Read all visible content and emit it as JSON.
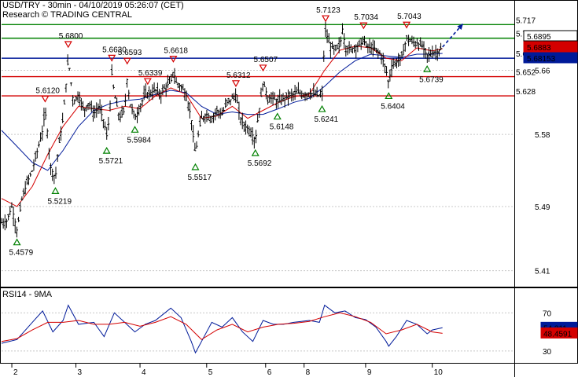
{
  "header": {
    "title": "USD/TRY - 30min - 04/10/2019 05:26:07 (CET)",
    "source": "Research © TRADING CENTRAL"
  },
  "colors": {
    "resistance": "#d40000",
    "support_green": "#008000",
    "pivot": "#001a99",
    "price_tag": "#001a99",
    "ma_fast": "#d40000",
    "ma_slow": "#001a99",
    "rsi_line": "#001a99",
    "rsi_ma": "#d40000",
    "candle": "#000000"
  },
  "chart_data": [
    {
      "type": "line",
      "title": "USD/TRY - 30min - 04/10/2019 05:26:07 (CET)",
      "x_ticks": [
        {
          "label": "2",
          "pos": 0.02
        },
        {
          "label": "3",
          "pos": 0.145
        },
        {
          "label": "4",
          "pos": 0.27
        },
        {
          "label": "5",
          "pos": 0.4
        },
        {
          "label": "6",
          "pos": 0.515
        },
        {
          "label": "8",
          "pos": 0.59
        },
        {
          "label": "9",
          "pos": 0.71
        },
        {
          "label": "10",
          "pos": 0.84
        }
      ],
      "y_ticks": [
        {
          "label": "5.66",
          "value": 5.66
        },
        {
          "label": "5.58",
          "value": 5.58
        },
        {
          "label": "5.49",
          "value": 5.49
        },
        {
          "label": "5.41",
          "value": 5.41
        }
      ],
      "ylim": [
        5.39,
        5.73
      ],
      "horizontal_levels": [
        {
          "value": 5.717,
          "label": "5.717",
          "kind": "support_green"
        },
        {
          "value": 5.7,
          "label": "5.7",
          "kind": "support_green"
        },
        {
          "value": 5.675,
          "label": "5.675",
          "kind": "pivot"
        },
        {
          "value": 5.652,
          "label": "5.652",
          "kind": "resistance"
        },
        {
          "value": 5.628,
          "label": "5.628",
          "kind": "resistance"
        }
      ],
      "price_tags": [
        {
          "label": "5.6895",
          "value": 5.6895,
          "kind": "box_white"
        },
        {
          "label": "5.6883",
          "value": 5.6883,
          "kind": "box_red"
        },
        {
          "label": "5.68153",
          "value": 5.68153,
          "kind": "box_blue"
        }
      ],
      "swing_annotations": [
        {
          "label": "5.4579",
          "t": 0.03,
          "value": 5.4579,
          "type": "low"
        },
        {
          "label": "5.6120",
          "t": 0.085,
          "value": 5.612,
          "type": "high"
        },
        {
          "label": "5.5219",
          "t": 0.105,
          "value": 5.5219,
          "type": "low"
        },
        {
          "label": "5.6800",
          "t": 0.13,
          "value": 5.68,
          "type": "high"
        },
        {
          "label": "5.6630",
          "t": 0.215,
          "value": 5.663,
          "type": "high"
        },
        {
          "label": "5.5721",
          "t": 0.205,
          "value": 5.5721,
          "type": "low"
        },
        {
          "label": "5.6593",
          "t": 0.245,
          "value": 5.6593,
          "type": "high"
        },
        {
          "label": "5.5984",
          "t": 0.26,
          "value": 5.5984,
          "type": "low"
        },
        {
          "label": "5.6339",
          "t": 0.285,
          "value": 5.6339,
          "type": "high"
        },
        {
          "label": "5.6618",
          "t": 0.335,
          "value": 5.6618,
          "type": "high"
        },
        {
          "label": "5.5517",
          "t": 0.378,
          "value": 5.5517,
          "type": "low"
        },
        {
          "label": "5.6312",
          "t": 0.457,
          "value": 5.6312,
          "type": "high"
        },
        {
          "label": "5.5692",
          "t": 0.495,
          "value": 5.5692,
          "type": "low"
        },
        {
          "label": "5.6507",
          "t": 0.51,
          "value": 5.6507,
          "type": "high"
        },
        {
          "label": "5.6148",
          "t": 0.538,
          "value": 5.6148,
          "type": "low"
        },
        {
          "label": "5.6241",
          "t": 0.625,
          "value": 5.6241,
          "type": "low"
        },
        {
          "label": "5.7123",
          "t": 0.632,
          "value": 5.7123,
          "type": "high"
        },
        {
          "label": "5.7034",
          "t": 0.706,
          "value": 5.7034,
          "type": "high"
        },
        {
          "label": "5.6404",
          "t": 0.755,
          "value": 5.6404,
          "type": "low"
        },
        {
          "label": "5.7043",
          "t": 0.79,
          "value": 5.7043,
          "type": "high"
        },
        {
          "label": "5.6739",
          "t": 0.83,
          "value": 5.6739,
          "type": "low"
        }
      ],
      "price_path": [
        [
          0.0,
          5.47
        ],
        [
          0.01,
          5.472
        ],
        [
          0.02,
          5.49
        ],
        [
          0.03,
          5.46
        ],
        [
          0.04,
          5.5
        ],
        [
          0.05,
          5.52
        ],
        [
          0.06,
          5.535
        ],
        [
          0.07,
          5.56
        ],
        [
          0.08,
          5.585
        ],
        [
          0.085,
          5.61
        ],
        [
          0.09,
          5.58
        ],
        [
          0.095,
          5.54
        ],
        [
          0.105,
          5.525
        ],
        [
          0.11,
          5.56
        ],
        [
          0.12,
          5.6
        ],
        [
          0.13,
          5.675
        ],
        [
          0.14,
          5.62
        ],
        [
          0.15,
          5.63
        ],
        [
          0.16,
          5.61
        ],
        [
          0.17,
          5.62
        ],
        [
          0.18,
          5.605
        ],
        [
          0.19,
          5.615
        ],
        [
          0.2,
          5.595
        ],
        [
          0.205,
          5.578
        ],
        [
          0.21,
          5.6
        ],
        [
          0.215,
          5.655
        ],
        [
          0.22,
          5.63
        ],
        [
          0.23,
          5.6
        ],
        [
          0.24,
          5.61
        ],
        [
          0.245,
          5.65
        ],
        [
          0.25,
          5.62
        ],
        [
          0.26,
          5.6
        ],
        [
          0.27,
          5.615
        ],
        [
          0.28,
          5.63
        ],
        [
          0.29,
          5.632
        ],
        [
          0.3,
          5.635
        ],
        [
          0.31,
          5.63
        ],
        [
          0.32,
          5.64
        ],
        [
          0.33,
          5.645
        ],
        [
          0.335,
          5.66
        ],
        [
          0.34,
          5.645
        ],
        [
          0.35,
          5.64
        ],
        [
          0.36,
          5.63
        ],
        [
          0.37,
          5.6
        ],
        [
          0.375,
          5.57
        ],
        [
          0.378,
          5.555
        ],
        [
          0.385,
          5.585
        ],
        [
          0.39,
          5.6
        ],
        [
          0.4,
          5.605
        ],
        [
          0.41,
          5.6
        ],
        [
          0.42,
          5.61
        ],
        [
          0.43,
          5.605
        ],
        [
          0.44,
          5.62
        ],
        [
          0.45,
          5.625
        ],
        [
          0.457,
          5.63
        ],
        [
          0.465,
          5.6
        ],
        [
          0.475,
          5.59
        ],
        [
          0.485,
          5.585
        ],
        [
          0.495,
          5.572
        ],
        [
          0.5,
          5.6
        ],
        [
          0.51,
          5.645
        ],
        [
          0.52,
          5.625
        ],
        [
          0.53,
          5.625
        ],
        [
          0.538,
          5.62
        ],
        [
          0.55,
          5.625
        ],
        [
          0.56,
          5.628
        ],
        [
          0.57,
          5.63
        ],
        [
          0.58,
          5.632
        ],
        [
          0.59,
          5.63
        ],
        [
          0.6,
          5.632
        ],
        [
          0.61,
          5.63
        ],
        [
          0.62,
          5.628
        ],
        [
          0.625,
          5.628
        ],
        [
          0.63,
          5.7
        ],
        [
          0.632,
          5.71
        ],
        [
          0.64,
          5.69
        ],
        [
          0.65,
          5.685
        ],
        [
          0.66,
          5.69
        ],
        [
          0.665,
          5.712
        ],
        [
          0.67,
          5.69
        ],
        [
          0.68,
          5.685
        ],
        [
          0.69,
          5.69
        ],
        [
          0.7,
          5.692
        ],
        [
          0.706,
          5.7
        ],
        [
          0.71,
          5.69
        ],
        [
          0.72,
          5.688
        ],
        [
          0.73,
          5.685
        ],
        [
          0.74,
          5.68
        ],
        [
          0.75,
          5.66
        ],
        [
          0.755,
          5.643
        ],
        [
          0.76,
          5.665
        ],
        [
          0.77,
          5.67
        ],
        [
          0.78,
          5.675
        ],
        [
          0.79,
          5.7
        ],
        [
          0.8,
          5.695
        ],
        [
          0.81,
          5.694
        ],
        [
          0.82,
          5.69
        ],
        [
          0.83,
          5.678
        ],
        [
          0.84,
          5.682
        ],
        [
          0.85,
          5.683
        ],
        [
          0.86,
          5.689
        ]
      ],
      "ma_fast_path": [
        [
          0.0,
          5.5
        ],
        [
          0.03,
          5.49
        ],
        [
          0.06,
          5.515
        ],
        [
          0.09,
          5.555
        ],
        [
          0.12,
          5.59
        ],
        [
          0.15,
          5.615
        ],
        [
          0.18,
          5.612
        ],
        [
          0.21,
          5.61
        ],
        [
          0.24,
          5.615
        ],
        [
          0.27,
          5.612
        ],
        [
          0.3,
          5.628
        ],
        [
          0.33,
          5.638
        ],
        [
          0.36,
          5.63
        ],
        [
          0.39,
          5.6
        ],
        [
          0.42,
          5.603
        ],
        [
          0.45,
          5.615
        ],
        [
          0.48,
          5.6
        ],
        [
          0.51,
          5.61
        ],
        [
          0.54,
          5.62
        ],
        [
          0.57,
          5.627
        ],
        [
          0.6,
          5.63
        ],
        [
          0.63,
          5.66
        ],
        [
          0.66,
          5.685
        ],
        [
          0.69,
          5.69
        ],
        [
          0.72,
          5.688
        ],
        [
          0.75,
          5.675
        ],
        [
          0.78,
          5.672
        ],
        [
          0.81,
          5.688
        ],
        [
          0.84,
          5.684
        ],
        [
          0.86,
          5.687
        ]
      ],
      "ma_slow_path": [
        [
          0.0,
          5.585
        ],
        [
          0.03,
          5.565
        ],
        [
          0.06,
          5.545
        ],
        [
          0.09,
          5.535
        ],
        [
          0.12,
          5.56
        ],
        [
          0.15,
          5.59
        ],
        [
          0.18,
          5.61
        ],
        [
          0.21,
          5.618
        ],
        [
          0.24,
          5.622
        ],
        [
          0.27,
          5.624
        ],
        [
          0.3,
          5.63
        ],
        [
          0.33,
          5.635
        ],
        [
          0.36,
          5.632
        ],
        [
          0.39,
          5.615
        ],
        [
          0.42,
          5.605
        ],
        [
          0.45,
          5.608
        ],
        [
          0.48,
          5.605
        ],
        [
          0.51,
          5.605
        ],
        [
          0.54,
          5.612
        ],
        [
          0.57,
          5.62
        ],
        [
          0.6,
          5.625
        ],
        [
          0.63,
          5.64
        ],
        [
          0.66,
          5.658
        ],
        [
          0.69,
          5.672
        ],
        [
          0.72,
          5.68
        ],
        [
          0.75,
          5.678
        ],
        [
          0.78,
          5.676
        ],
        [
          0.81,
          5.68
        ],
        [
          0.84,
          5.68
        ],
        [
          0.86,
          5.681
        ]
      ],
      "projection": {
        "from": [
          0.86,
          5.689
        ],
        "to": [
          0.9,
          5.718
        ]
      }
    },
    {
      "type": "line",
      "title": "RSI14 - 9MA",
      "y_ticks": [
        {
          "label": "70",
          "value": 70
        },
        {
          "label": "30",
          "value": 30
        }
      ],
      "ylim": [
        15,
        95
      ],
      "value_tags": [
        {
          "label": "54.311",
          "value": 54.311,
          "kind": "blue"
        },
        {
          "label": "48.4591",
          "value": 48.4591,
          "kind": "red"
        }
      ],
      "series": [
        {
          "name": "RSI14",
          "values": [
            [
              0.0,
              38
            ],
            [
              0.03,
              42
            ],
            [
              0.06,
              60
            ],
            [
              0.08,
              72
            ],
            [
              0.1,
              50
            ],
            [
              0.12,
              62
            ],
            [
              0.13,
              78
            ],
            [
              0.15,
              58
            ],
            [
              0.18,
              60
            ],
            [
              0.2,
              45
            ],
            [
              0.22,
              70
            ],
            [
              0.24,
              60
            ],
            [
              0.26,
              50
            ],
            [
              0.28,
              58
            ],
            [
              0.3,
              62
            ],
            [
              0.33,
              75
            ],
            [
              0.35,
              65
            ],
            [
              0.37,
              40
            ],
            [
              0.378,
              28
            ],
            [
              0.39,
              40
            ],
            [
              0.41,
              60
            ],
            [
              0.43,
              55
            ],
            [
              0.45,
              65
            ],
            [
              0.47,
              50
            ],
            [
              0.49,
              40
            ],
            [
              0.51,
              62
            ],
            [
              0.53,
              58
            ],
            [
              0.55,
              58
            ],
            [
              0.57,
              60
            ],
            [
              0.6,
              62
            ],
            [
              0.62,
              60
            ],
            [
              0.63,
              78
            ],
            [
              0.65,
              70
            ],
            [
              0.67,
              72
            ],
            [
              0.69,
              65
            ],
            [
              0.71,
              63
            ],
            [
              0.73,
              55
            ],
            [
              0.75,
              40
            ],
            [
              0.755,
              35
            ],
            [
              0.77,
              45
            ],
            [
              0.79,
              62
            ],
            [
              0.81,
              58
            ],
            [
              0.83,
              48
            ],
            [
              0.84,
              52
            ],
            [
              0.86,
              54.311
            ]
          ]
        },
        {
          "name": "9MA",
          "values": [
            [
              0.0,
              40
            ],
            [
              0.03,
              43
            ],
            [
              0.06,
              52
            ],
            [
              0.09,
              60
            ],
            [
              0.12,
              60
            ],
            [
              0.15,
              62
            ],
            [
              0.18,
              58
            ],
            [
              0.21,
              58
            ],
            [
              0.24,
              60
            ],
            [
              0.27,
              56
            ],
            [
              0.3,
              60
            ],
            [
              0.33,
              66
            ],
            [
              0.36,
              58
            ],
            [
              0.39,
              42
            ],
            [
              0.42,
              52
            ],
            [
              0.45,
              58
            ],
            [
              0.48,
              50
            ],
            [
              0.51,
              55
            ],
            [
              0.54,
              58
            ],
            [
              0.57,
              59
            ],
            [
              0.6,
              61
            ],
            [
              0.63,
              66
            ],
            [
              0.66,
              70
            ],
            [
              0.69,
              66
            ],
            [
              0.72,
              60
            ],
            [
              0.75,
              48
            ],
            [
              0.78,
              52
            ],
            [
              0.81,
              58
            ],
            [
              0.84,
              50
            ],
            [
              0.86,
              48.4591
            ]
          ]
        }
      ]
    }
  ]
}
